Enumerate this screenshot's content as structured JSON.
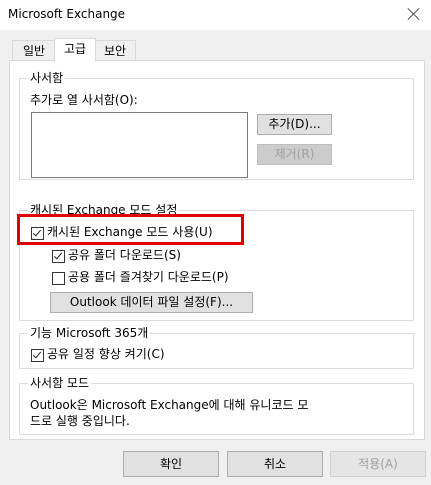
{
  "window": {
    "title": "Microsoft Exchange"
  },
  "tabs": [
    {
      "label": "일반",
      "active": false
    },
    {
      "label": "고급",
      "active": true
    },
    {
      "label": "보안",
      "active": false
    }
  ],
  "mailbox_group": {
    "legend": "사서함",
    "open_label": "추가로 열 사서함(O):",
    "add_button": "추가(D)...",
    "remove_button": "제거(R)"
  },
  "cached_group": {
    "legend": "캐시된 Exchange 모드 설정",
    "use_cached": {
      "label": "캐시된 Exchange 모드 사용(U)",
      "checked": true
    },
    "download_shared": {
      "label": "공유 폴더 다운로드(S)",
      "checked": true
    },
    "download_public": {
      "label": "공용 폴더 즐겨찾기 다운로드(P)",
      "checked": false
    },
    "ost_button": "Outlook 데이터 파일 설정(F)..."
  },
  "m365_group": {
    "legend": "기능 Microsoft 365개",
    "shared_calendar": {
      "label": "공유 일정 향상 켜기(C)",
      "checked": true
    }
  },
  "mailbox_mode_group": {
    "legend": "사서함 모드",
    "text_line1": "Outlook은 Microsoft Exchange에 대해 유니코드 모",
    "text_line2": "드로 실행 중입니다."
  },
  "footer": {
    "ok": "확인",
    "cancel": "취소",
    "apply": "적용(A)"
  },
  "colors": {
    "highlight": "#e00000"
  }
}
